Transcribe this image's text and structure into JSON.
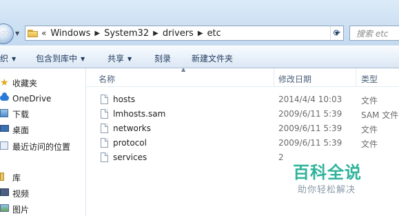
{
  "address": {
    "chevrons": "«",
    "crumbs": [
      "Windows",
      "System32",
      "drivers",
      "etc"
    ]
  },
  "search": {
    "placeholder": "搜索 etc"
  },
  "toolbar": {
    "organize_label": "织",
    "include_label": "包含到库中",
    "share_label": "共享",
    "burn_label": "刻录",
    "new_folder_label": "新建文件夹"
  },
  "nav": {
    "favorites": "收藏夹",
    "onedrive": "OneDrive",
    "downloads": "下载",
    "desktop": "桌面",
    "recent": "最近访问的位置",
    "libraries": "库",
    "videos": "视频",
    "pictures": "图片"
  },
  "columns": {
    "name": "名称",
    "modified": "修改日期",
    "type": "类型"
  },
  "files": [
    {
      "name": "hosts",
      "date": "2014/4/4 10:03",
      "type": "文件"
    },
    {
      "name": "lmhosts.sam",
      "date": "2009/6/11 5:39",
      "type": "SAM 文件"
    },
    {
      "name": "networks",
      "date": "2009/6/11 5:39",
      "type": "文件"
    },
    {
      "name": "protocol",
      "date": "2009/6/11 5:39",
      "type": "文件"
    },
    {
      "name": "services",
      "date": "2",
      "type": ""
    }
  ],
  "watermark": {
    "logo": "百科全说",
    "tagline": "助你轻松解决"
  },
  "colors": {
    "toolbar_text": "#1e395b",
    "watermark": "#2fb39a",
    "header_text": "#4c607a"
  }
}
